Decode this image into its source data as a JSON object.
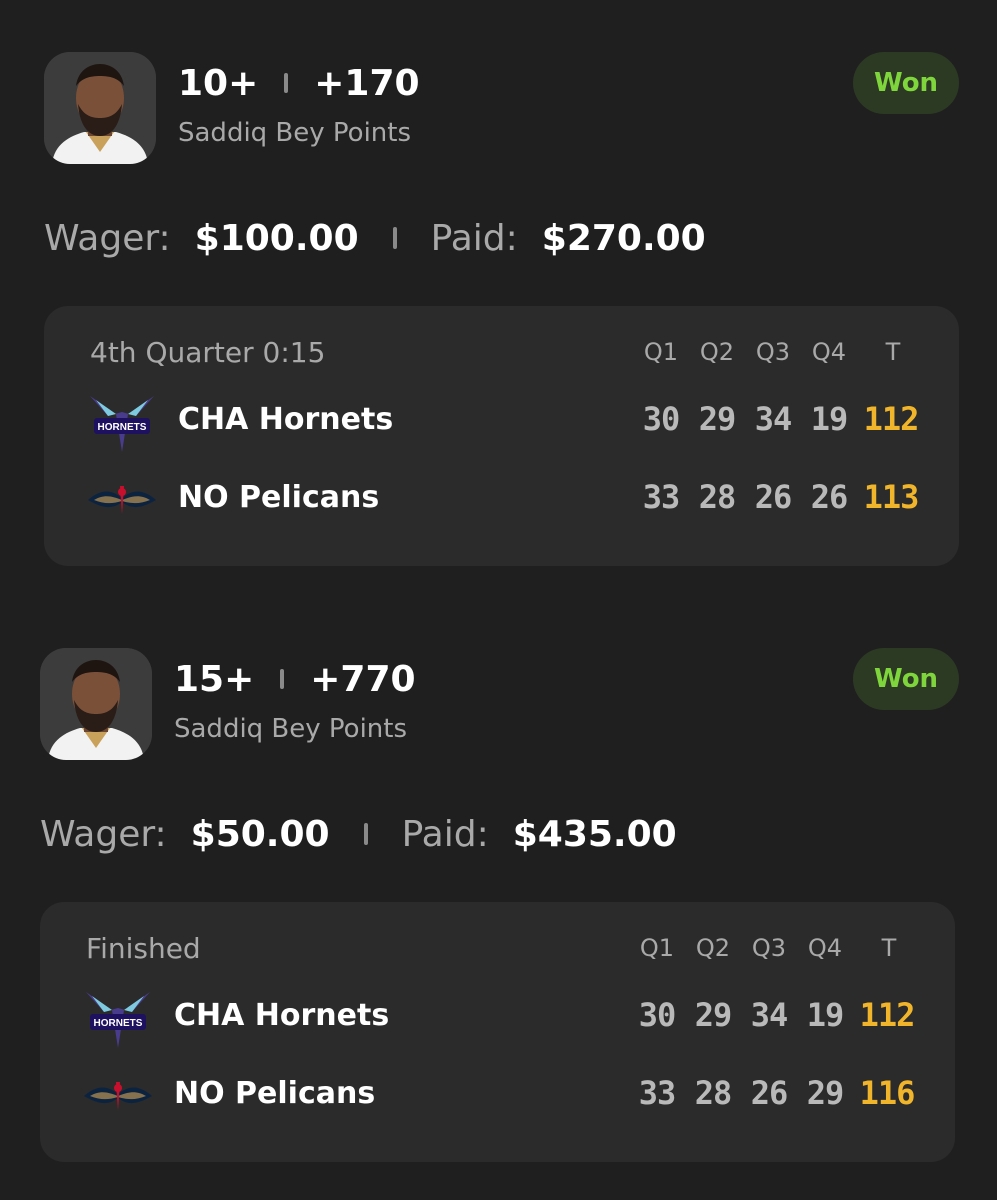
{
  "bets": [
    {
      "line": "10+",
      "odds": "+170",
      "market": "Saddiq Bey Points",
      "result": "Won",
      "wager_label": "Wager:",
      "wager": "$100.00",
      "paid_label": "Paid:",
      "paid": "$270.00",
      "game": {
        "status": "4th Quarter 0:15",
        "columns": [
          "Q1",
          "Q2",
          "Q3",
          "Q4",
          "T"
        ],
        "teams": [
          {
            "name": "CHA Hornets",
            "logo": "hornets-logo",
            "scores": [
              "30",
              "29",
              "34",
              "19"
            ],
            "total": "112"
          },
          {
            "name": "NO Pelicans",
            "logo": "pelicans-logo",
            "scores": [
              "33",
              "28",
              "26",
              "26"
            ],
            "total": "113"
          }
        ]
      }
    },
    {
      "line": "15+",
      "odds": "+770",
      "market": "Saddiq Bey Points",
      "result": "Won",
      "wager_label": "Wager:",
      "wager": "$50.00",
      "paid_label": "Paid:",
      "paid": "$435.00",
      "game": {
        "status": "Finished",
        "columns": [
          "Q1",
          "Q2",
          "Q3",
          "Q4",
          "T"
        ],
        "teams": [
          {
            "name": "CHA Hornets",
            "logo": "hornets-logo",
            "scores": [
              "30",
              "29",
              "34",
              "19"
            ],
            "total": "112"
          },
          {
            "name": "NO Pelicans",
            "logo": "pelicans-logo",
            "scores": [
              "33",
              "28",
              "26",
              "29"
            ],
            "total": "116"
          }
        ]
      }
    }
  ],
  "colors": {
    "background": "#1f1f1f",
    "card": "#2b2b2b",
    "won_text": "#7fd53c",
    "won_bg": "#2c3a23",
    "total_score": "#f0b52b",
    "muted_text": "#a9a9a9"
  }
}
